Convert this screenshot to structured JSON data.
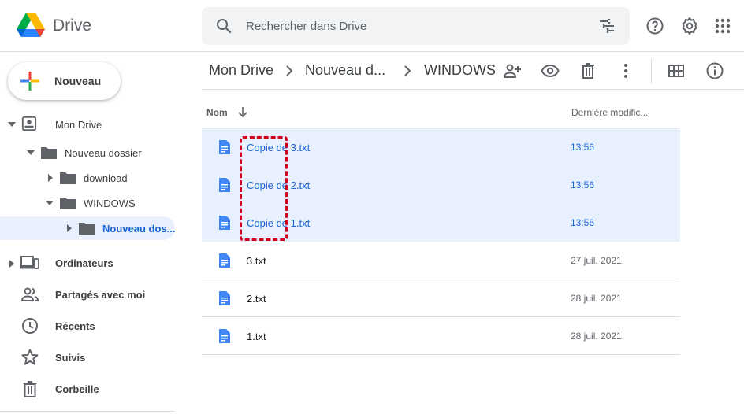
{
  "header": {
    "brand": "Drive",
    "search_placeholder": "Rechercher dans Drive"
  },
  "sidebar": {
    "new_label": "Nouveau",
    "tree": [
      {
        "label": "Mon Drive"
      },
      {
        "label": "Nouveau dossier"
      },
      {
        "label": "download"
      },
      {
        "label": "WINDOWS"
      },
      {
        "label": "Nouveau dos..."
      }
    ],
    "nav": [
      {
        "label": "Ordinateurs",
        "icon": "computer-icon"
      },
      {
        "label": "Partagés avec moi",
        "icon": "people-icon"
      },
      {
        "label": "Récents",
        "icon": "clock-icon"
      },
      {
        "label": "Suivis",
        "icon": "star-icon"
      },
      {
        "label": "Corbeille",
        "icon": "trash-icon"
      }
    ]
  },
  "toolbar": {
    "breadcrumbs": [
      "Mon Drive",
      "Nouveau d...",
      "WINDOWS"
    ]
  },
  "table": {
    "col_name": "Nom",
    "col_modified": "Dernière modific...",
    "rows": [
      {
        "name": "Copie de 3.txt",
        "modified": "13:56",
        "selected": true
      },
      {
        "name": "Copie de 2.txt",
        "modified": "13:56",
        "selected": true
      },
      {
        "name": "Copie de 1.txt",
        "modified": "13:56",
        "selected": true
      },
      {
        "name": "3.txt",
        "modified": "27 juil. 2021",
        "selected": false
      },
      {
        "name": "2.txt",
        "modified": "28 juil. 2021",
        "selected": false
      },
      {
        "name": "1.txt",
        "modified": "28 juil. 2021",
        "selected": false
      }
    ]
  },
  "colors": {
    "accent": "#1967d2",
    "selection": "#e8f0fe",
    "highlight": "#d0021b",
    "doc_icon": "#4285f4"
  }
}
